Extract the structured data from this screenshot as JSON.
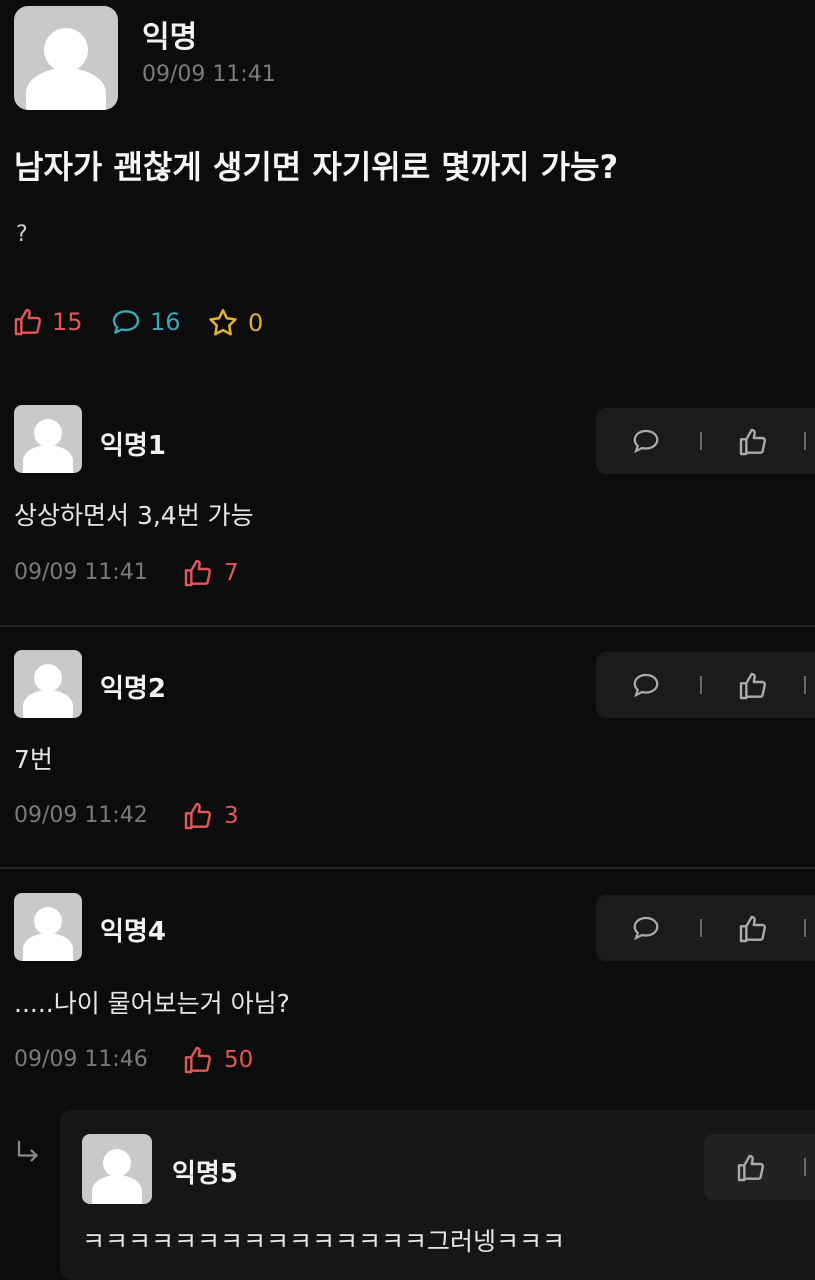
{
  "post": {
    "author": "익명",
    "time": "09/09 11:41",
    "title": "남자가 괜찮게 생기면 자기위로 몇까지 가능?",
    "body": "?",
    "likes": "15",
    "comments": "16",
    "scraps": "0"
  },
  "comments": [
    {
      "author": "익명1",
      "text": "상상하면서 3,4번 가능",
      "time": "09/09 11:41",
      "likes": "7"
    },
    {
      "author": "익명2",
      "text": "7번",
      "time": "09/09 11:42",
      "likes": "3"
    },
    {
      "author": "익명4",
      "text": ".....나이 물어보는거 아님?",
      "time": "09/09 11:46",
      "likes": "50"
    }
  ],
  "reply": {
    "author": "익명5",
    "text": "ㅋㅋㅋㅋㅋㅋㅋㅋㅋㅋㅋㅋㅋㅋㅋ그러넹ㅋㅋㅋ"
  },
  "colors": {
    "like": "#e35757",
    "comment": "#3aa6b9",
    "scrap": "#e0b030",
    "background": "#0c0c0c"
  }
}
